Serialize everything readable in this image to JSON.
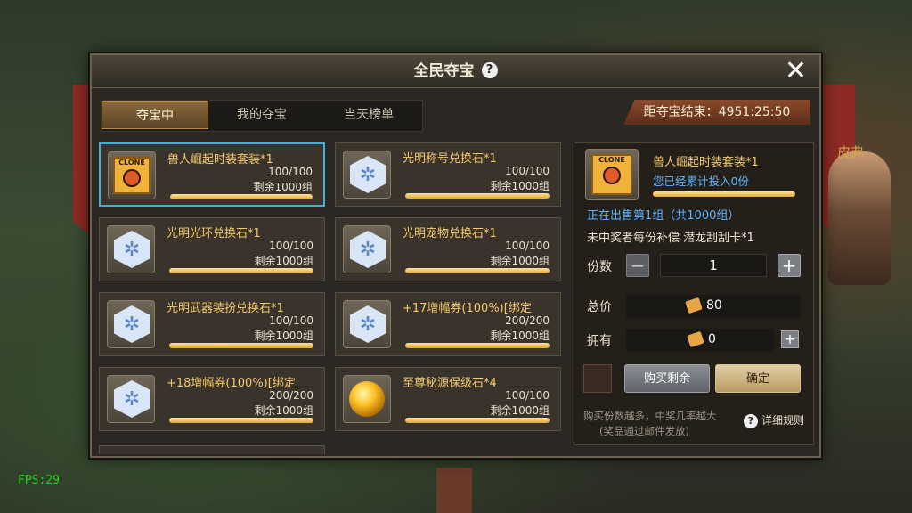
{
  "hud": {
    "fps": "FPS:29",
    "npc_name": "皮弗"
  },
  "dialog": {
    "title": "全民夺宝",
    "help": "?",
    "close": "✕",
    "tabs": [
      {
        "label": "夺宝中",
        "active": true
      },
      {
        "label": "我的夺宝",
        "active": false
      },
      {
        "label": "当天榜单",
        "active": false
      }
    ],
    "timer": "距夺宝结束：4951:25:50"
  },
  "items": [
    {
      "name": "兽人崛起时装套装*1",
      "count": "100/100",
      "remain": "剩余1000组",
      "icon": "clone-costume-icon",
      "progress": 1.0
    },
    {
      "name": "光明称号兑换石*1",
      "count": "100/100",
      "remain": "剩余1000组",
      "icon": "light-stone-icon",
      "progress": 1.0
    },
    {
      "name": "光明光环兑换石*1",
      "count": "100/100",
      "remain": "剩余1000组",
      "icon": "light-stone-icon",
      "progress": 1.0
    },
    {
      "name": "光明宠物兑换石*1",
      "count": "100/100",
      "remain": "剩余1000组",
      "icon": "light-stone-icon",
      "progress": 1.0
    },
    {
      "name": "光明武器装扮兑换石*1",
      "count": "100/100",
      "remain": "剩余1000组",
      "icon": "light-stone-icon",
      "progress": 1.0
    },
    {
      "name": "+17增幅券(100%)[绑定",
      "count": "200/200",
      "remain": "剩余1000组",
      "icon": "light-stone-icon",
      "progress": 1.0
    },
    {
      "name": "+18增幅券(100%)[绑定",
      "count": "200/200",
      "remain": "剩余1000组",
      "icon": "light-stone-icon",
      "progress": 1.0
    },
    {
      "name": "至尊秘源保级石*4",
      "count": "100/100",
      "remain": "剩余1000组",
      "icon": "golden-orb-icon",
      "progress": 1.0
    }
  ],
  "detail": {
    "name": "兽人崛起时装套装*1",
    "invested": "您已经累计投入0份",
    "status": "正在出售第1组（共1000组）",
    "compensation": "未中奖者每份补偿 潜龙刮刮卡*1",
    "qty_label": "份数",
    "qty_value": "1",
    "minus": "−",
    "plus": "+",
    "total_label": "总价",
    "total_value": "80",
    "own_label": "拥有",
    "own_value": "0",
    "buy_rest": "购买剩余",
    "confirm": "确定",
    "note1": "购买份数越多，中奖几率越大",
    "note2": "(奖品通过邮件发放)",
    "rules": "详细规则",
    "clone_text": "CLONE"
  }
}
